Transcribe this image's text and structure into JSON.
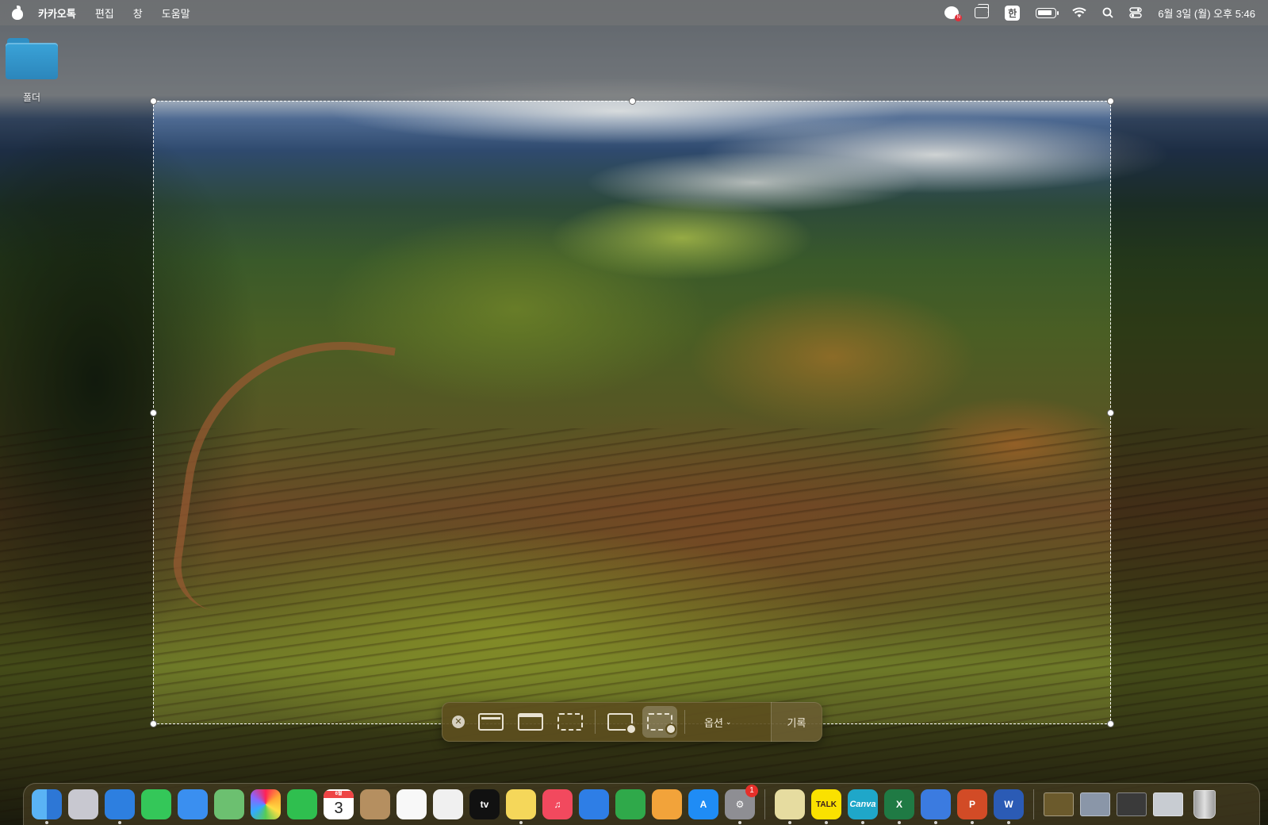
{
  "menubar": {
    "app_name": "카카오톡",
    "menus": [
      "편집",
      "창",
      "도움말"
    ],
    "input_source": "한",
    "clock": "6월 3일 (월) 오후 5:46",
    "kakao_badge": "N"
  },
  "desktop": {
    "folder_label": "폴더"
  },
  "toolbar": {
    "close_label": "✕",
    "options_label": "옵션",
    "record_label": "기록",
    "active_tool": "record-selected-portion"
  },
  "dock": {
    "apps": [
      {
        "name": "finder",
        "label": "",
        "color": "#3b8de0",
        "running": true
      },
      {
        "name": "launchpad",
        "label": "",
        "color": "#c8c8d0",
        "running": false
      },
      {
        "name": "safari",
        "label": "",
        "color": "#2d7fe0",
        "running": true
      },
      {
        "name": "messages",
        "label": "",
        "color": "#34c759",
        "running": false
      },
      {
        "name": "mail",
        "label": "",
        "color": "#3a8ff0",
        "running": false
      },
      {
        "name": "maps",
        "label": "",
        "color": "#6cc070",
        "running": false
      },
      {
        "name": "photos",
        "label": "",
        "color": "#f4f4f4",
        "running": false
      },
      {
        "name": "facetime",
        "label": "",
        "color": "#2fbf4f",
        "running": false
      },
      {
        "name": "calendar",
        "label": "3",
        "month": "6월",
        "color": "#ffffff",
        "running": false
      },
      {
        "name": "contacts",
        "label": "",
        "color": "#b58f60",
        "running": false
      },
      {
        "name": "reminders",
        "label": "",
        "color": "#f8f8f8",
        "running": false
      },
      {
        "name": "freeform",
        "label": "",
        "color": "#f0f0f0",
        "running": false
      },
      {
        "name": "tv",
        "label": "tv",
        "color": "#111111",
        "running": false
      },
      {
        "name": "notes",
        "label": "",
        "color": "#f5d75a",
        "running": true
      },
      {
        "name": "music",
        "label": "♫",
        "color": "#f2495e",
        "running": false
      },
      {
        "name": "keynote",
        "label": "",
        "color": "#2e7ee6",
        "running": false
      },
      {
        "name": "numbers",
        "label": "",
        "color": "#2fa94a",
        "running": false
      },
      {
        "name": "pages",
        "label": "",
        "color": "#f2a33a",
        "running": false
      },
      {
        "name": "app-store",
        "label": "A",
        "color": "#1f8cf5",
        "running": false
      },
      {
        "name": "system-settings",
        "label": "⚙",
        "color": "#8e8e93",
        "running": true,
        "badge": "1"
      }
    ],
    "apps_right": [
      {
        "name": "stickies",
        "label": "",
        "color": "#e6dca0",
        "running": true
      },
      {
        "name": "kakaotalk",
        "label": "TALK",
        "color": "#fae100",
        "running": true
      },
      {
        "name": "canva",
        "label": "Canva",
        "color": "#1fa7c9",
        "running": true
      },
      {
        "name": "excel",
        "label": "X",
        "color": "#1f7a44",
        "running": true
      },
      {
        "name": "whatsapp-mac",
        "label": "",
        "color": "#3b7be0",
        "running": true
      },
      {
        "name": "powerpoint",
        "label": "P",
        "color": "#d24b26",
        "running": true
      },
      {
        "name": "word",
        "label": "W",
        "color": "#2b5bb5",
        "running": true
      }
    ],
    "thumbnails": [
      "thumb-1",
      "thumb-2",
      "thumb-3",
      "thumb-4"
    ],
    "trash": "trash-icon"
  }
}
